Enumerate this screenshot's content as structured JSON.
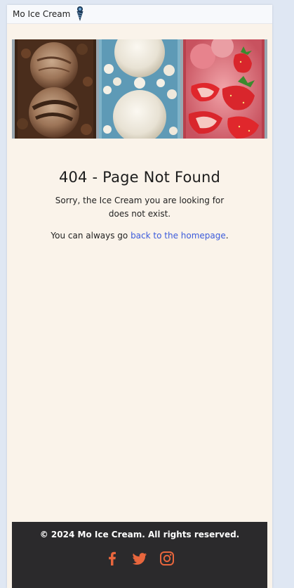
{
  "brand": {
    "name": "Mo Ice Cream",
    "icon": "ice-cream-cone-icon"
  },
  "hero": {
    "image": "ice-cream-tubs-chocolate-vanilla-strawberry"
  },
  "error": {
    "title": "404 - Page Not Found",
    "message": "Sorry, the Ice Cream you are looking for does not exist.",
    "home_prefix": "You can always go ",
    "home_link": "back to the homepage",
    "home_suffix": "."
  },
  "footer": {
    "copyright": "© 2024 Mo Ice Cream. All rights reserved.",
    "social": [
      {
        "icon": "facebook-icon"
      },
      {
        "icon": "twitter-icon"
      },
      {
        "icon": "instagram-icon"
      }
    ]
  },
  "colors": {
    "page_bg": "#faf3ea",
    "footer_bg": "#2b2a2c",
    "social_accent": "#e8663d",
    "link": "#3b5bdb"
  }
}
